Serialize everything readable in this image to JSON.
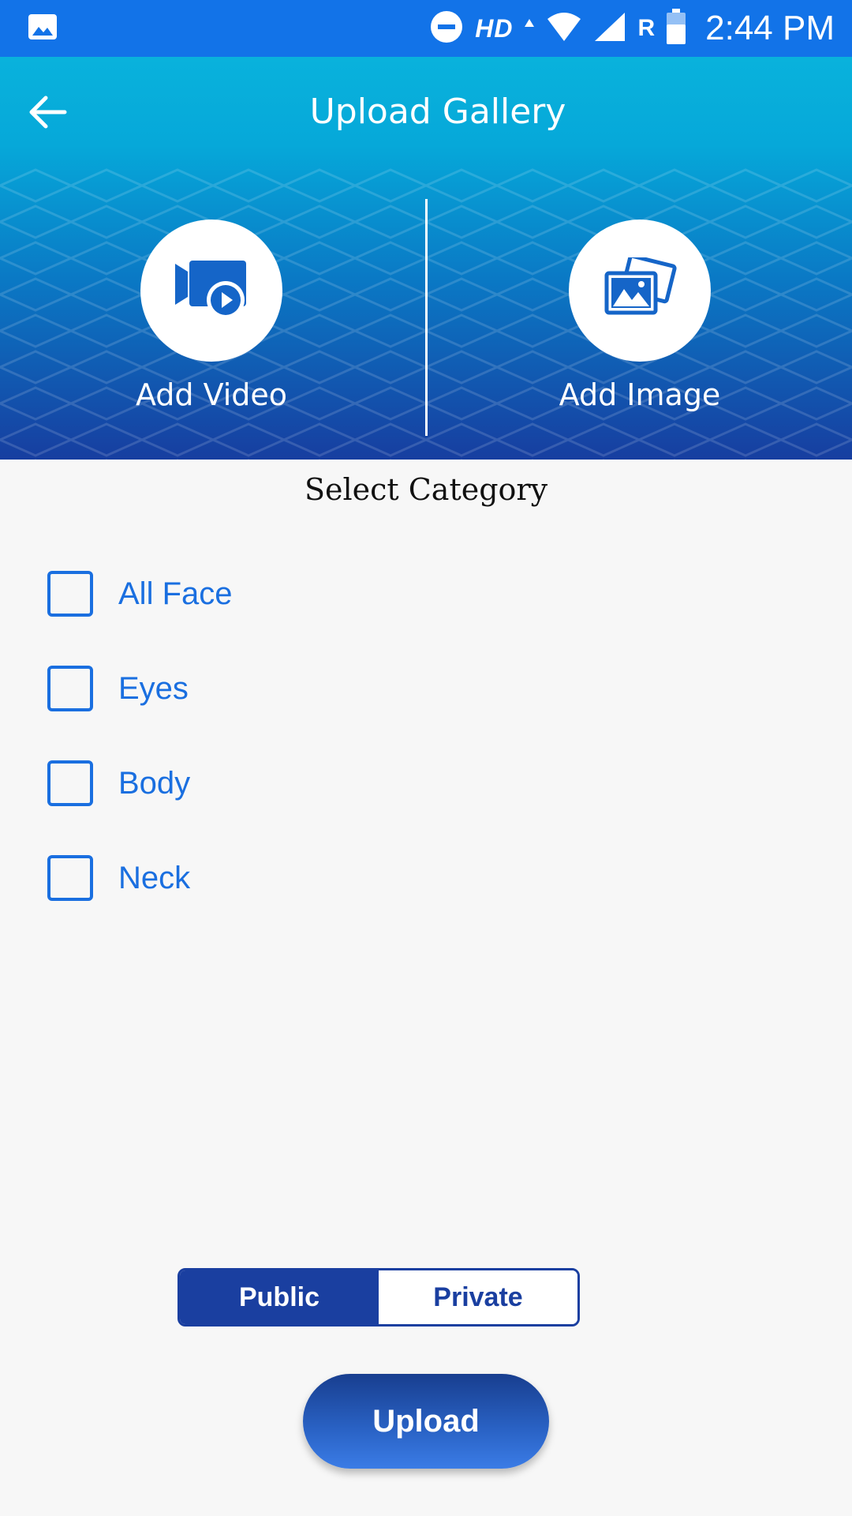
{
  "status_bar": {
    "network_label": "HD",
    "roaming_label": "R",
    "time": "2:44 PM",
    "icons": [
      "gallery-icon",
      "do-not-disturb-icon",
      "wifi-icon",
      "signal-icon",
      "battery-icon"
    ]
  },
  "header": {
    "title": "Upload Gallery",
    "back_icon": "arrow-left-icon",
    "actions": [
      {
        "label": "Add Video",
        "icon": "video-camera-icon"
      },
      {
        "label": "Add Image",
        "icon": "image-gallery-icon"
      }
    ]
  },
  "category_section": {
    "title": "Select Category",
    "items": [
      {
        "label": "All Face",
        "checked": false
      },
      {
        "label": "Eyes",
        "checked": false
      },
      {
        "label": "Body",
        "checked": false
      },
      {
        "label": "Neck",
        "checked": false
      }
    ]
  },
  "visibility": {
    "options": [
      "Public",
      "Private"
    ],
    "selected": "Public"
  },
  "upload_button": {
    "label": "Upload"
  },
  "colors": {
    "status_bar": "#1273e8",
    "header_top": "#09b2dc",
    "header_bottom": "#173ea0",
    "accent": "#1a6fe0",
    "toggle_active": "#1a3fa0",
    "background": "#f7f7f7"
  }
}
